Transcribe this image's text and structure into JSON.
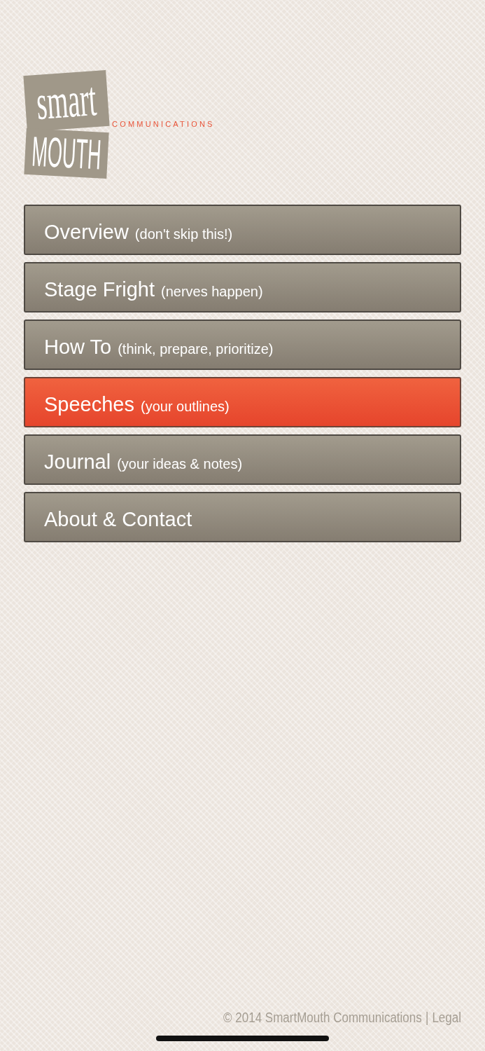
{
  "logo": {
    "word_top": "smart",
    "word_bottom": "MOUTH",
    "tagline": "COMMUNICATIONS"
  },
  "menu": [
    {
      "title": "Overview",
      "note": "(don't skip this!)",
      "selected": false
    },
    {
      "title": "Stage Fright",
      "note": "(nerves happen)",
      "selected": false
    },
    {
      "title": "How To",
      "note": "(think, prepare, prioritize)",
      "selected": false
    },
    {
      "title": "Speeches",
      "note": "(your outlines)",
      "selected": true
    },
    {
      "title": "Journal",
      "note": "(your ideas & notes)",
      "selected": false
    },
    {
      "title": "About & Contact",
      "selected": false
    }
  ],
  "footer": {
    "copyright": "© 2014 SmartMouth Communications",
    "separator": "|",
    "link": "Legal"
  }
}
